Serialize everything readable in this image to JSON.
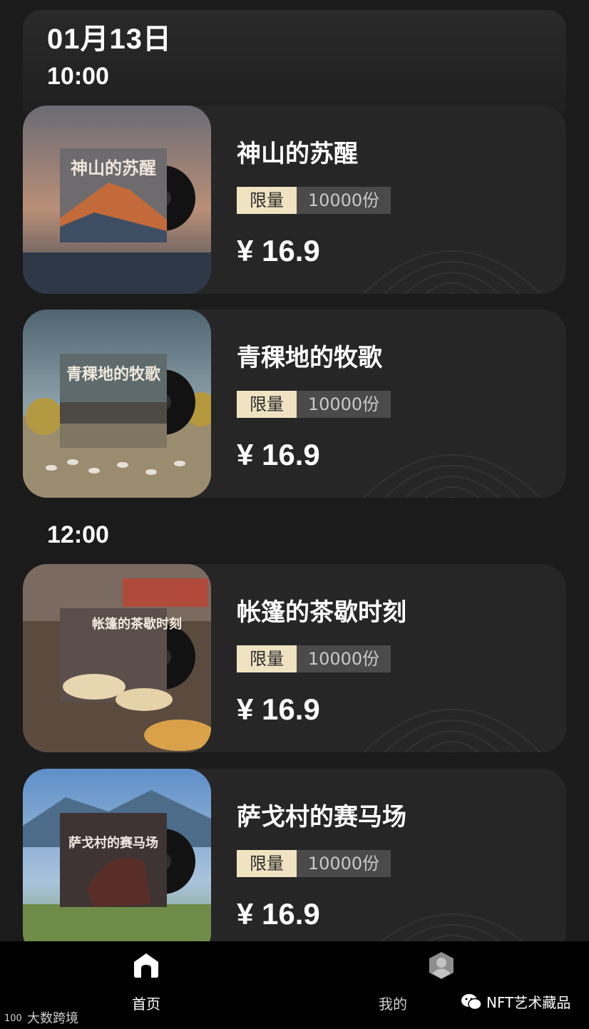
{
  "header": {
    "date": "01月13日"
  },
  "groups": [
    {
      "time": "10:00"
    },
    {
      "time": "12:00"
    }
  ],
  "cards": [
    {
      "title": "神山的苏醒",
      "limit_label": "限量",
      "quantity": "10000份",
      "price": "¥ 16.9",
      "cover_text": "神山的苏醒"
    },
    {
      "title": "青稞地的牧歌",
      "limit_label": "限量",
      "quantity": "10000份",
      "price": "¥ 16.9",
      "cover_text": "青稞地的牧歌"
    },
    {
      "title": "帐篷的茶歇时刻",
      "limit_label": "限量",
      "quantity": "10000份",
      "price": "¥ 16.9",
      "cover_text": "帐篷的茶歇时刻"
    },
    {
      "title": "萨戈村的赛马场",
      "limit_label": "限量",
      "quantity": "10000份",
      "price": "¥ 16.9",
      "cover_text": "萨戈村的赛马场"
    }
  ],
  "tabbar": {
    "home_label": "首页",
    "mine_label": "我的"
  },
  "watermarks": {
    "left": "大数跨境",
    "right": "NFT艺术藏品"
  },
  "colors": {
    "background": "#1b1b1b",
    "card": "#262626",
    "limit_tag": "#efe3c2",
    "quantity_tag": "#4a4a4a"
  }
}
